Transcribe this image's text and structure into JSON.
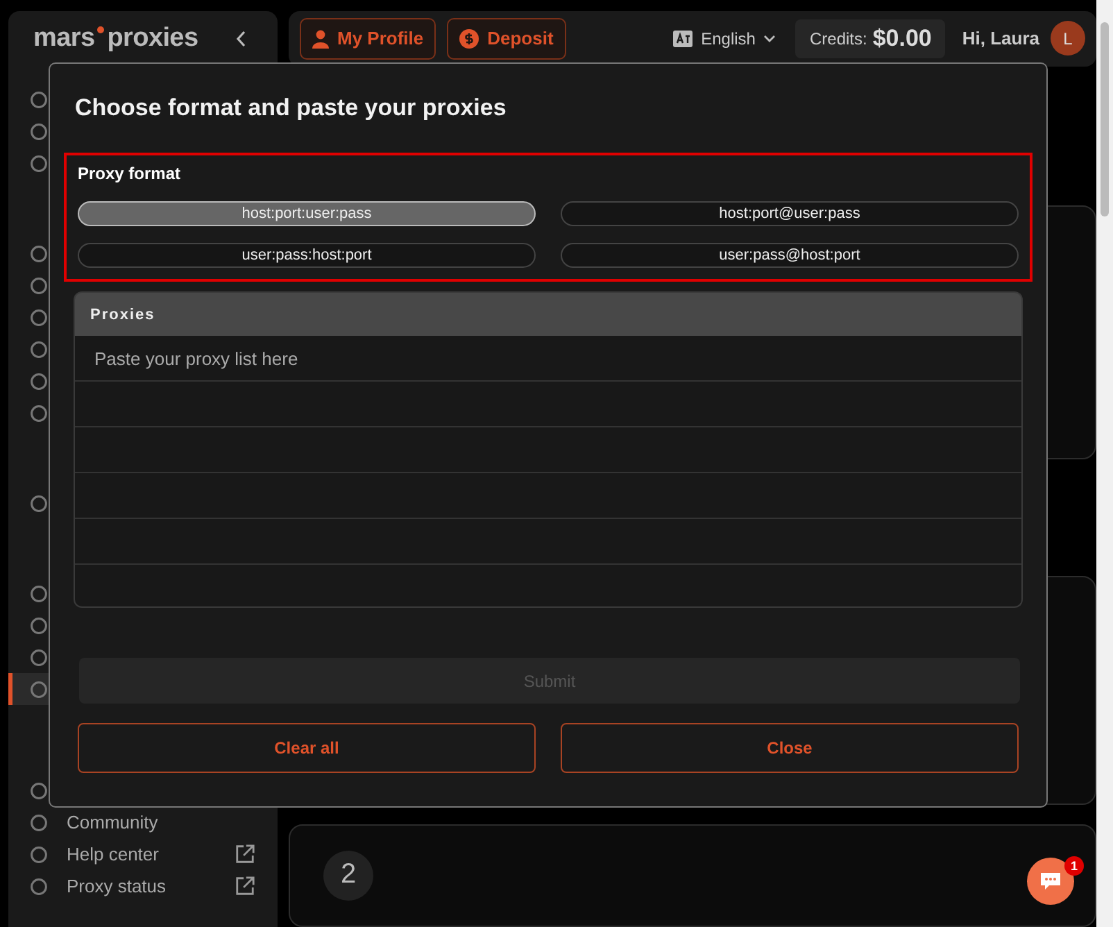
{
  "sidebar": {
    "logo": [
      "mars",
      "proxies"
    ],
    "groups": [
      {
        "items": [
          {
            "selected": false
          },
          {
            "selected": false
          },
          {
            "selected": false
          }
        ]
      },
      {
        "items": [
          {
            "selected": false
          },
          {
            "selected": false
          },
          {
            "selected": false
          },
          {
            "selected": false
          },
          {
            "selected": false
          },
          {
            "selected": false
          }
        ]
      },
      {
        "items": [
          {
            "selected": false
          }
        ]
      },
      {
        "items": [
          {
            "selected": false
          },
          {
            "selected": false
          },
          {
            "selected": false
          },
          {
            "selected": true
          }
        ]
      },
      {
        "items": [
          {
            "selected": false
          },
          {
            "label": "Community",
            "selected": false
          },
          {
            "label": "Help center",
            "selected": false,
            "external": true
          },
          {
            "label": "Proxy status",
            "selected": false,
            "external": true
          }
        ]
      }
    ]
  },
  "topbar": {
    "buttons": [
      {
        "label": "My Profile"
      },
      {
        "label": "Deposit"
      }
    ],
    "language": "English",
    "credits_label": "Credits:",
    "credits_value": "$0.00",
    "greeting": "Hi, Laura",
    "avatar": "L"
  },
  "step_card": {
    "number": "2"
  },
  "modal": {
    "title": "Choose format and paste your proxies",
    "format_label": "Proxy format",
    "formats": [
      {
        "label": "host:port:user:pass",
        "selected": true
      },
      {
        "label": "host:port@user:pass",
        "selected": false
      },
      {
        "label": "user:pass:host:port",
        "selected": false
      },
      {
        "label": "user:pass@host:port",
        "selected": false
      }
    ],
    "proxies": {
      "header": "Proxies",
      "placeholder": "Paste your proxy list here"
    },
    "submit": {
      "label": "Submit",
      "disabled": true
    },
    "actions": [
      "Clear all",
      "Close"
    ]
  },
  "chat": {
    "badge": "1"
  }
}
